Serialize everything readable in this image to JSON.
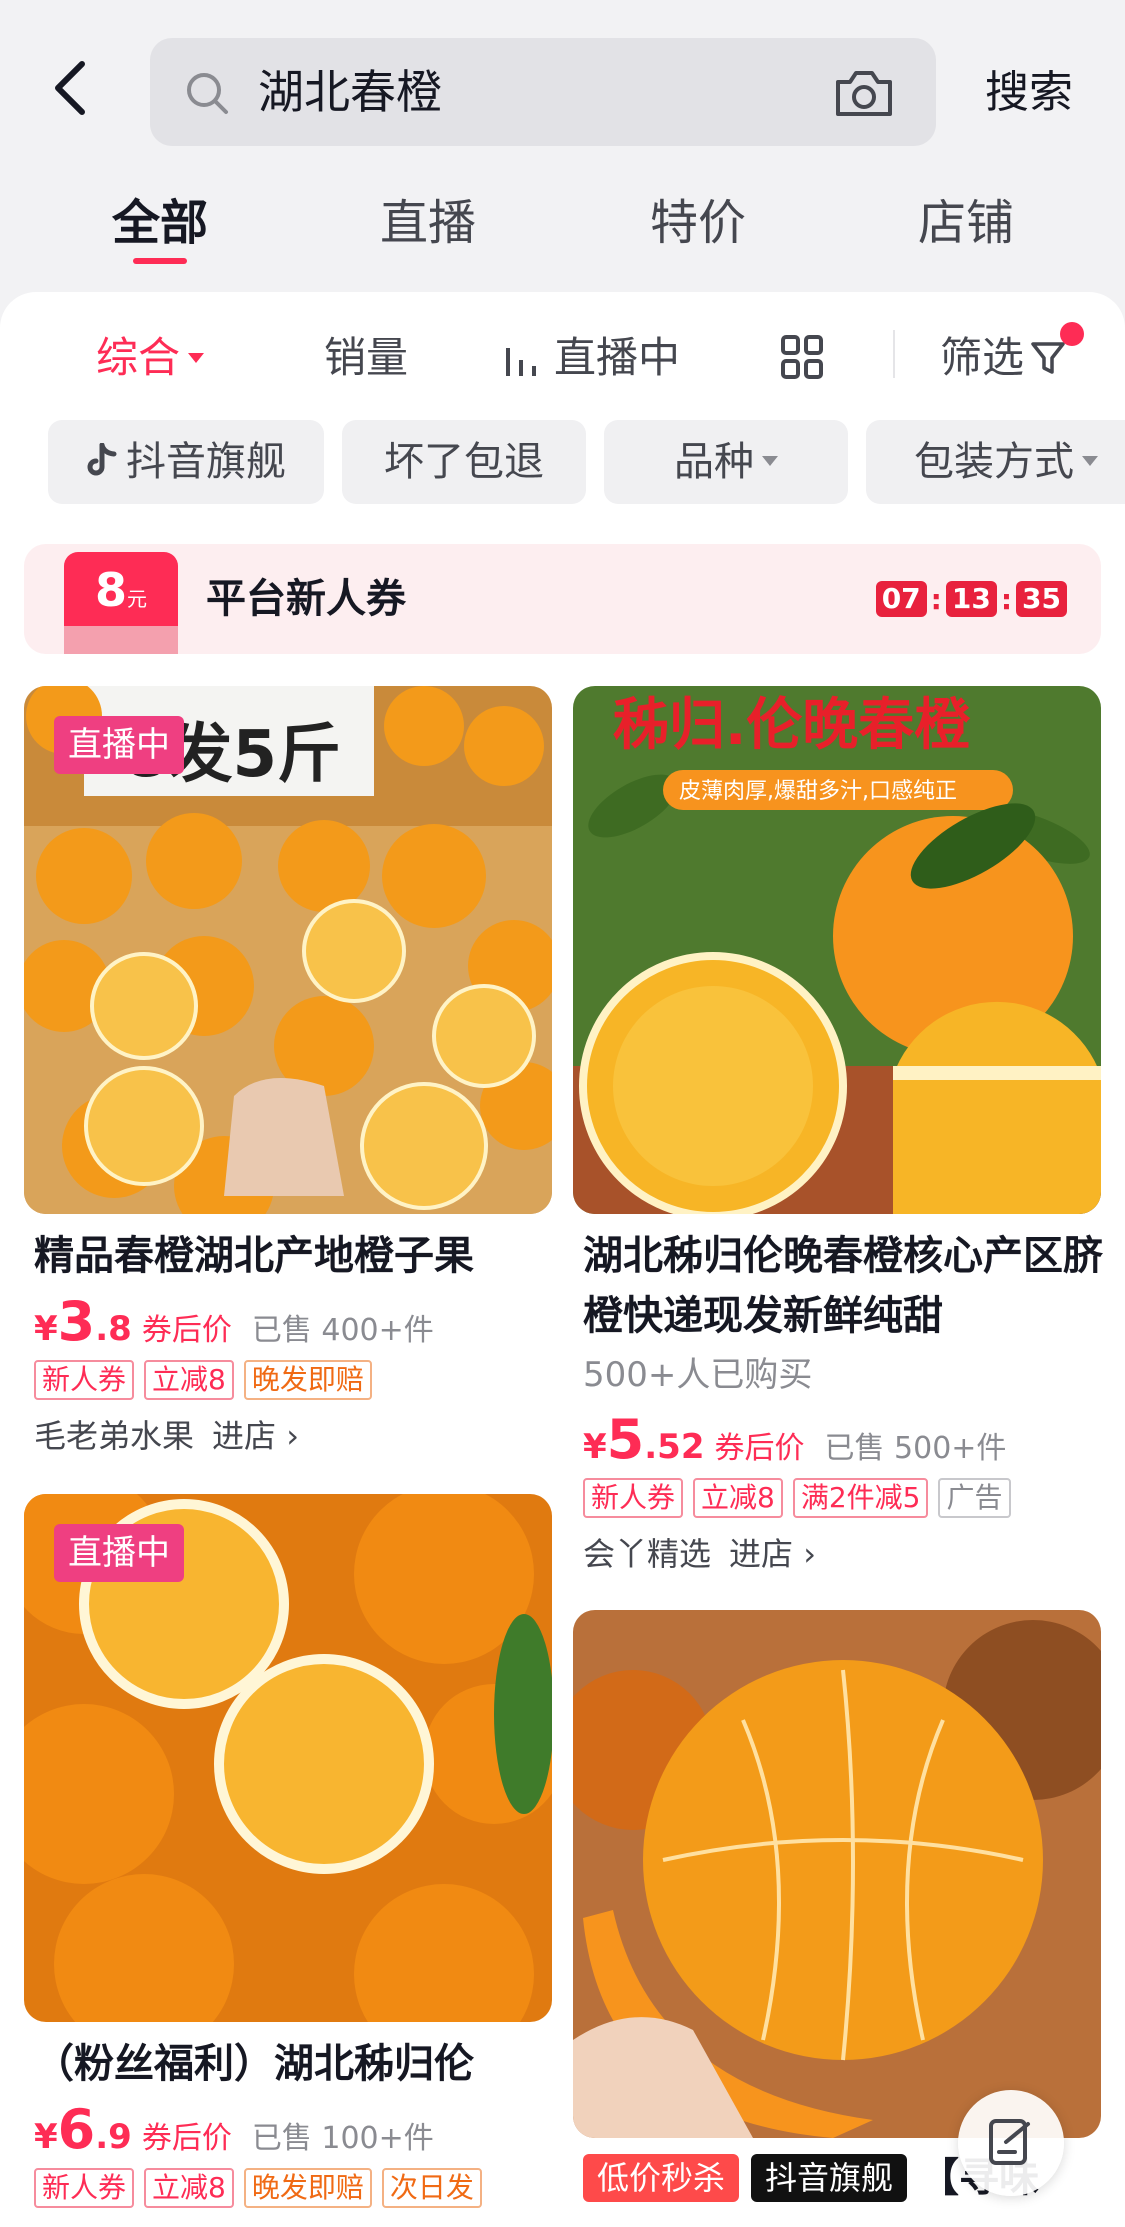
{
  "search": {
    "query": "湖北春橙",
    "button": "搜索"
  },
  "tabs": [
    "全部",
    "直播",
    "特价",
    "店铺"
  ],
  "sort": {
    "comprehensive": "综合",
    "sales": "销量",
    "live": "直播中",
    "filter": "筛选"
  },
  "chips": [
    "抖音旗舰",
    "坏了包退",
    "品种",
    "包装方式"
  ],
  "coupon": {
    "amount": "8",
    "unit": "元",
    "title": "平台新人券",
    "countdown": [
      "07",
      "13",
      "35"
    ]
  },
  "products": [
    {
      "live_tag": "直播中",
      "image_text": "8发5斤",
      "title": "精品春橙湖北产地橙子果",
      "price_symbol": "¥",
      "price_int": "3",
      "price_dec": ".8",
      "price_note": "券后价",
      "sold": "已售 400+件",
      "badges": [
        "新人券",
        "立减8",
        "晚发即赔"
      ],
      "shop": "毛老弟水果",
      "shop_enter": "进店 ›"
    },
    {
      "image_title": "秭归.伦晚春橙",
      "image_subtitle": "皮薄肉厚,爆甜多汁,口感纯正",
      "title": "湖北秭归伦晚春橙核心产区脐橙快递现发新鲜纯甜",
      "buyers": "500+人已购买",
      "price_symbol": "¥",
      "price_int": "5",
      "price_dec": ".52",
      "price_note": "券后价",
      "sold": "已售 500+件",
      "badges": [
        "新人券",
        "立减8",
        "满2件减5",
        "广告"
      ],
      "shop": "会丫精选",
      "shop_enter": "进店 ›"
    },
    {
      "live_tag": "直播中",
      "title": "（粉丝福利）湖北秭归伦",
      "price_symbol": "¥",
      "price_int": "6",
      "price_dec": ".9",
      "price_note": "券后价",
      "sold": "已售 100+件",
      "badges": [
        "新人券",
        "立减8",
        "晚发即赔",
        "次日发"
      ]
    },
    {
      "promo_tags": [
        "低价秒杀",
        "抖音旗舰"
      ],
      "title_start": "【寻味"
    }
  ],
  "colors": {
    "accent": "#fe2c55",
    "live": "#ef3f81",
    "orange": "#f7941d"
  }
}
